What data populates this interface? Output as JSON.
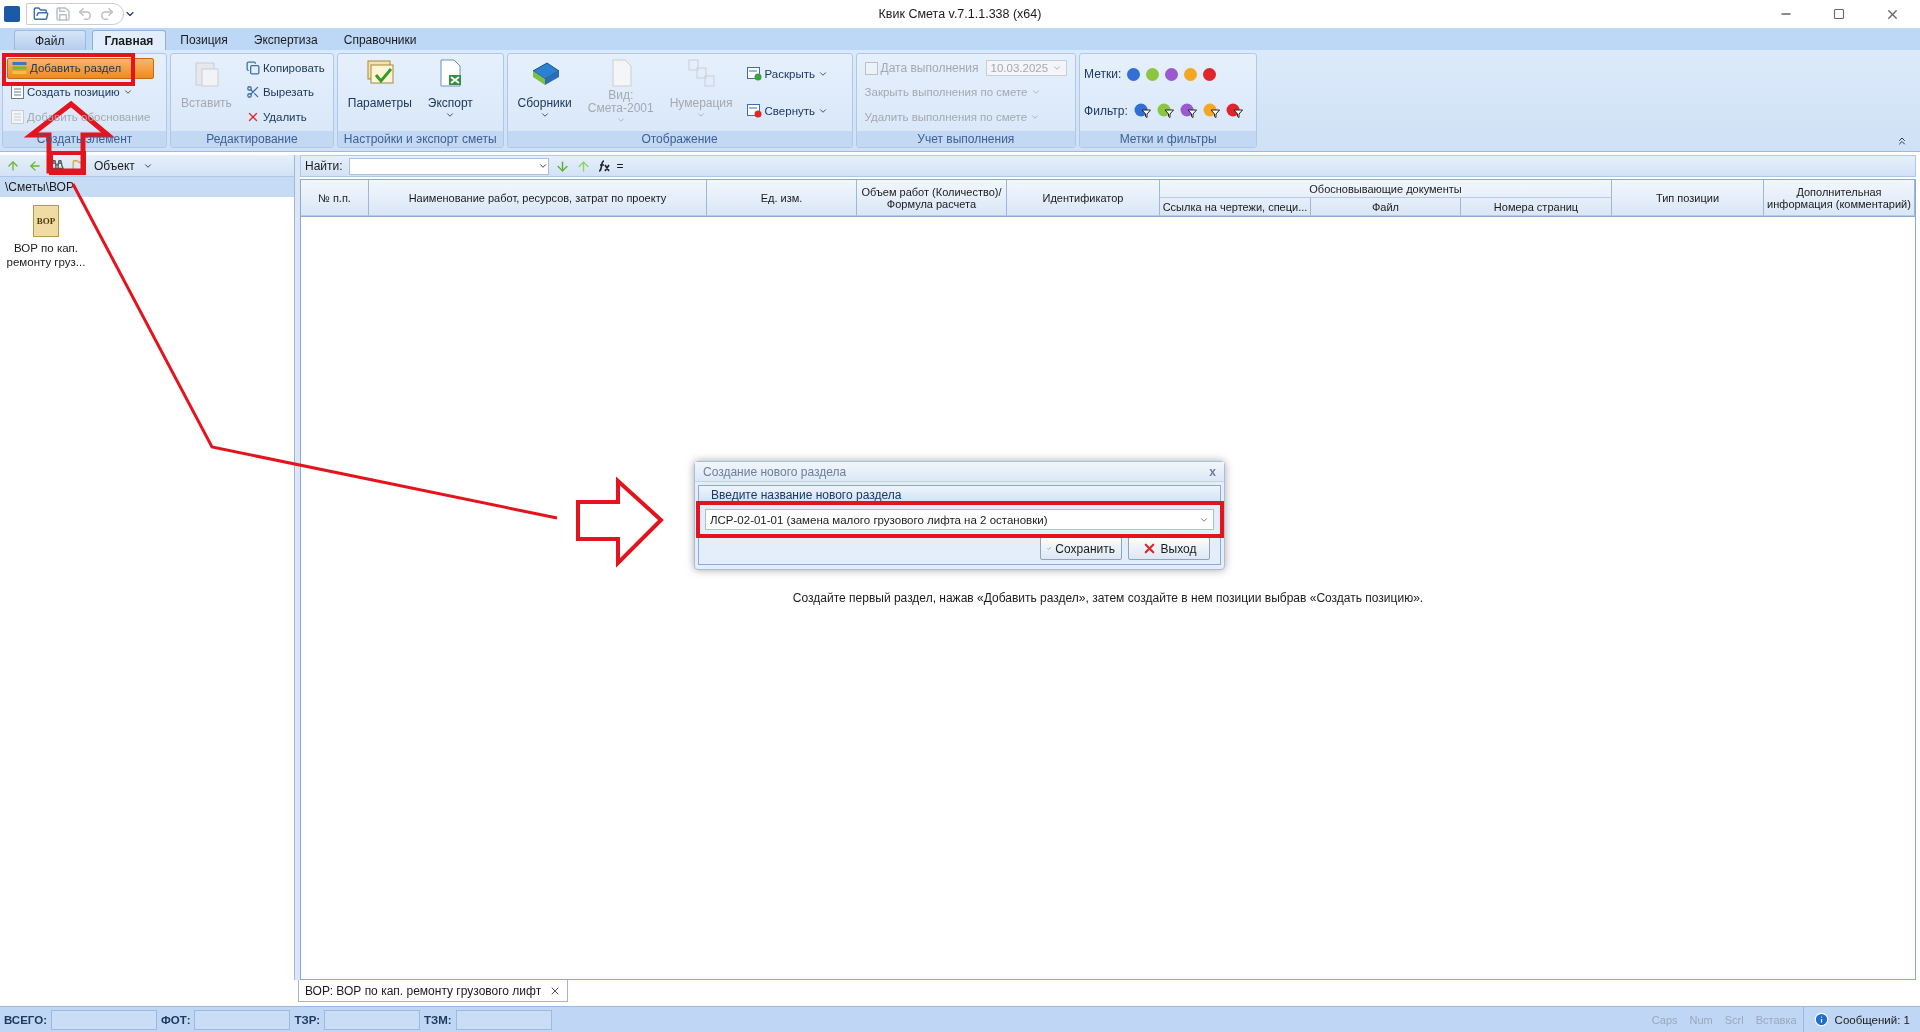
{
  "window": {
    "title": "Квик Смета v.7.1.1.338 (x64)"
  },
  "ribbon_tabs": [
    {
      "label": "Файл",
      "kind": "file",
      "selected": false
    },
    {
      "label": "Главная",
      "kind": "tab",
      "selected": true
    },
    {
      "label": "Позиция",
      "kind": "tab",
      "selected": false
    },
    {
      "label": "Экспертиза",
      "kind": "tab",
      "selected": false
    },
    {
      "label": "Справочники",
      "kind": "tab",
      "selected": false
    }
  ],
  "ribbon_groups": [
    {
      "title": "Создать элемент",
      "columns": [
        {
          "kind": "stack",
          "items": [
            {
              "kind": "button",
              "label": "Добавить раздел",
              "highlighted": true,
              "disabled": false,
              "dropdown": false
            },
            {
              "kind": "button",
              "label": "Создать позицию",
              "highlighted": false,
              "disabled": false,
              "dropdown": true
            },
            {
              "kind": "button",
              "label": "Добавить обоснование",
              "highlighted": false,
              "disabled": true,
              "dropdown": false
            }
          ]
        }
      ]
    },
    {
      "title": "Редактирование",
      "columns": [
        {
          "kind": "large",
          "items": [
            {
              "label": "Вставить",
              "disabled": true,
              "dropdown": false
            }
          ]
        },
        {
          "kind": "stack",
          "items": [
            {
              "kind": "button",
              "label": "Копировать",
              "disabled": false,
              "dropdown": false
            },
            {
              "kind": "button",
              "label": "Вырезать",
              "disabled": false,
              "dropdown": false
            },
            {
              "kind": "button",
              "label": "Удалить",
              "disabled": false,
              "dropdown": false
            }
          ]
        }
      ]
    },
    {
      "title": "Настройки и экспорт сметы",
      "columns": [
        {
          "kind": "large",
          "items": [
            {
              "label": "Параметры",
              "disabled": false,
              "dropdown": false
            },
            {
              "label": "Экспорт",
              "disabled": false,
              "dropdown": true
            }
          ]
        }
      ]
    },
    {
      "title": "Отображение",
      "columns": [
        {
          "kind": "large",
          "items": [
            {
              "label": "Сборники",
              "disabled": false,
              "dropdown": true
            },
            {
              "label": "Вид:",
              "sublabel": "Смета-2001",
              "disabled": true,
              "dropdown": true
            },
            {
              "label": "Нумерация",
              "disabled": true,
              "dropdown": true
            }
          ]
        },
        {
          "kind": "stack",
          "items": [
            {
              "kind": "button",
              "label": "Раскрыть",
              "disabled": false,
              "dropdown": true
            },
            {
              "kind": "button",
              "label": "Свернуть",
              "disabled": false,
              "dropdown": true
            }
          ]
        }
      ]
    },
    {
      "title": "Учет выполнения",
      "columns": [
        {
          "kind": "stack",
          "items": [
            {
              "kind": "checkbox",
              "label": "Дата выполнения",
              "checked": false,
              "disabled": true,
              "value": "10.03.2025"
            },
            {
              "kind": "button",
              "label": "Закрыть выполнения по смете",
              "disabled": true,
              "dropdown": true
            },
            {
              "kind": "button",
              "label": "Удалить выполнения по смете",
              "disabled": true,
              "dropdown": true
            }
          ]
        }
      ]
    },
    {
      "title": "Метки и фильтры",
      "columns": [
        {
          "kind": "marks",
          "items": [
            {
              "kind": "dots",
              "label": "Метки:",
              "colors": [
                {
                  "color": "#2f6fd6"
                },
                {
                  "color": "#8cc63f"
                },
                {
                  "color": "#9b59d0"
                },
                {
                  "color": "#f5a623"
                },
                {
                  "color": "#e0262b"
                }
              ]
            },
            {
              "kind": "filters",
              "label": "Фильтр:",
              "colors": [
                {
                  "color": "#2f6fd6"
                },
                {
                  "color": "#8cc63f"
                },
                {
                  "color": "#9b59d0"
                },
                {
                  "color": "#f5a623"
                },
                {
                  "color": "#e0262b"
                }
              ]
            }
          ]
        }
      ]
    }
  ],
  "left_panel": {
    "toolbar_label": "Объект",
    "path": "\\Сметы\\ВОР",
    "files": [
      {
        "badge": "ВОР",
        "name": "ВОР по кап. ремонту груз..."
      }
    ]
  },
  "find_bar": {
    "label": "Найти:",
    "equals": "="
  },
  "table": {
    "columns": [
      {
        "label": "№ п.п."
      },
      {
        "label": "Наименование работ, ресурсов, затрат по проекту"
      },
      {
        "label": "Ед. изм."
      },
      {
        "label": "Объем работ (Количество)/ Формула расчета"
      },
      {
        "label": "Идентификатор"
      },
      {
        "label": "Обосновывающие документы",
        "children": [
          {
            "label": "Ссылка на чертежи, специ..."
          },
          {
            "label": "Файл"
          },
          {
            "label": "Номера страниц"
          }
        ]
      },
      {
        "label": "Тип позиции"
      },
      {
        "label": "Дополнительная информация (комментарий)"
      }
    ],
    "empty_message": "Создайте первый раздел, нажав «Добавить раздел», затем создайте в нем позиции выбрав «Создать позицию»."
  },
  "dialog": {
    "title": "Создание нового раздела",
    "close": "x",
    "prompt": "Введите название нового раздела",
    "value": "ЛСР-02-01-01 (замена малого грузового лифта на 2 остановки)",
    "buttons": [
      {
        "kind": "ok",
        "label": "Сохранить"
      },
      {
        "kind": "cancel",
        "label": "Выход"
      }
    ]
  },
  "document_tabs": [
    {
      "label": "ВОР: ВОР по кап. ремонту грузового лифт",
      "selected": true
    }
  ],
  "status_bar": {
    "fields": [
      {
        "label": "ВСЕГО:"
      },
      {
        "label": "ФОТ:"
      },
      {
        "label": "ТЗР:"
      },
      {
        "label": "ТЗМ:"
      }
    ],
    "indicators": [
      {
        "label": "Caps",
        "on": false
      },
      {
        "label": "Num",
        "on": false
      },
      {
        "label": "Scrl",
        "on": false
      },
      {
        "label": "Вставка",
        "on": false
      }
    ],
    "messages": "Сообщений: 1"
  }
}
